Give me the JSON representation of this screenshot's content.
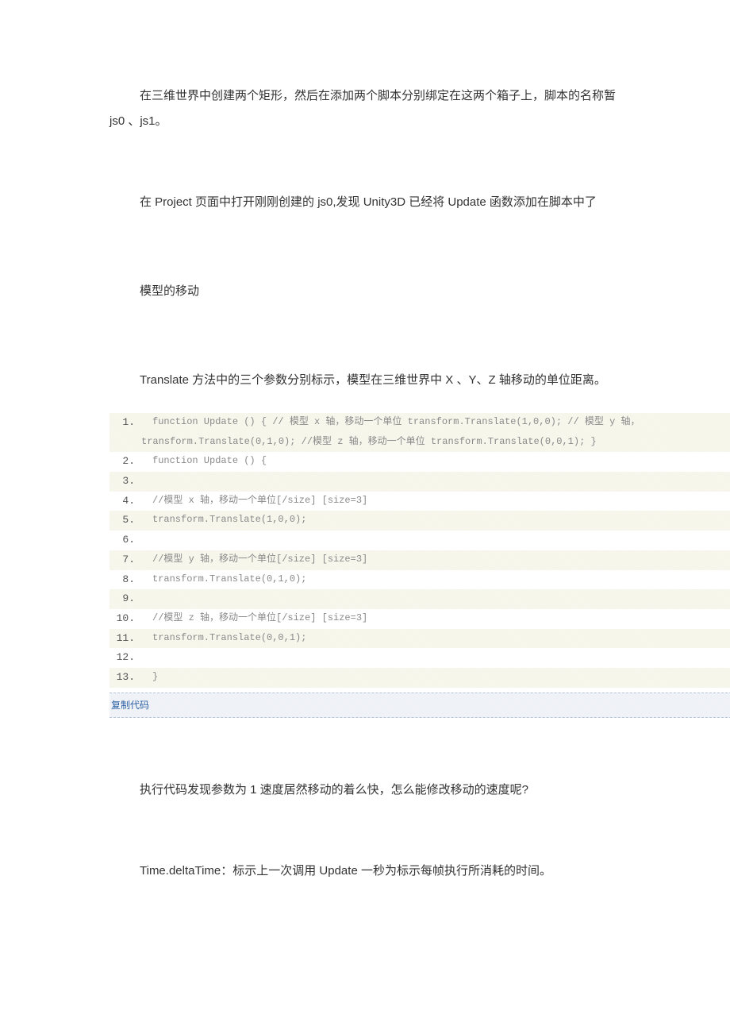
{
  "paragraphs": {
    "p1": "在三维世界中创建两个矩形，然后在添加两个脚本分别绑定在这两个箱子上，脚本的名称暂",
    "p1b": "js0 、js1。",
    "p2": "在 Project 页面中打开刚刚创建的 js0,发现 Unity3D 已经将 Update 函数添加在脚本中了",
    "p3": "模型的移动",
    "p4": "Translate 方法中的三个参数分别标示，模型在三维世界中 X 、Y、Z 轴移动的单位距离。",
    "p5": "执行代码发现参数为 1 速度居然移动的着么快，怎么能修改移动的速度呢?",
    "p6": "Time.deltaTime：标示上一次调用 Update 一秒为标示每帧执行所消耗的时间。"
  },
  "code": {
    "lines": [
      {
        "num": "1",
        "hl": true,
        "text": "function Update () { // 模型 x 轴，移动一个单位 transform.Translate(1,0,0); // 模型 y 轴，"
      },
      {
        "num": "",
        "hl": true,
        "text": "transform.Translate(0,1,0); //模型 z 轴，移动一个单位 transform.Translate(0,0,1); }",
        "cont": true
      },
      {
        "num": "2",
        "hl": false,
        "text": "function Update () {"
      },
      {
        "num": "3",
        "hl": true,
        "text": ""
      },
      {
        "num": "4",
        "hl": false,
        "text": "//模型 x 轴，移动一个单位[/size] [size=3]"
      },
      {
        "num": "5",
        "hl": true,
        "text": "transform.Translate(1,0,0);"
      },
      {
        "num": "6",
        "hl": false,
        "text": ""
      },
      {
        "num": "7",
        "hl": true,
        "text": "//模型 y 轴，移动一个单位[/size] [size=3]"
      },
      {
        "num": "8",
        "hl": false,
        "text": "transform.Translate(0,1,0);"
      },
      {
        "num": "9",
        "hl": true,
        "text": ""
      },
      {
        "num": "10",
        "hl": false,
        "text": "//模型 z 轴，移动一个单位[/size] [size=3]"
      },
      {
        "num": "11",
        "hl": true,
        "text": "transform.Translate(0,0,1);"
      },
      {
        "num": "12",
        "hl": false,
        "text": ""
      },
      {
        "num": "13",
        "hl": true,
        "text": "}"
      }
    ],
    "copy_label": "复制代码"
  }
}
